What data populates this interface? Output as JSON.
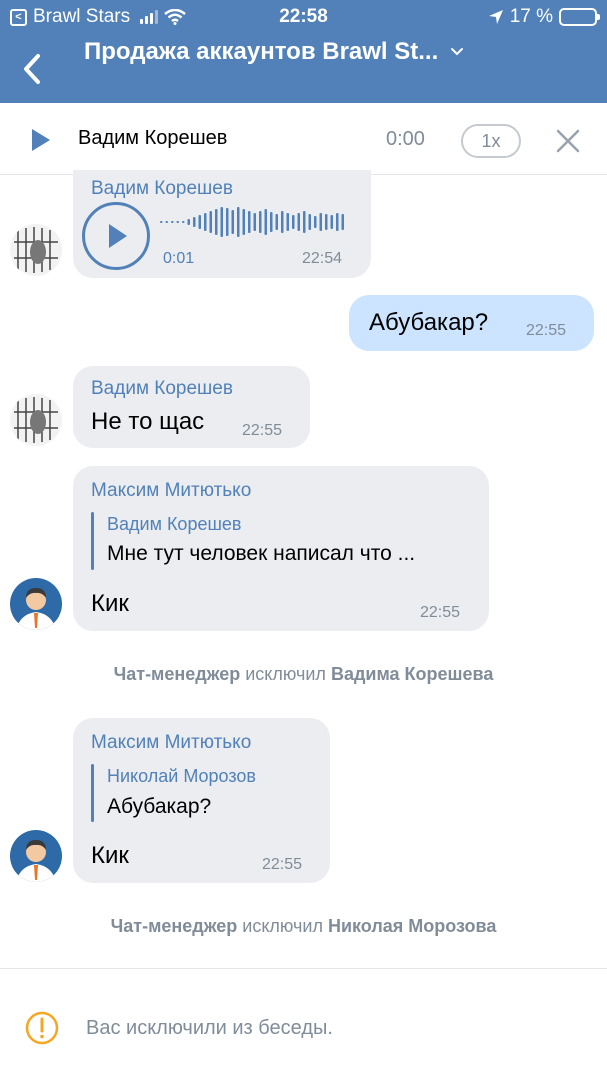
{
  "status_bar": {
    "back_app": "Brawl Stars",
    "time": "22:58",
    "battery": "17 %"
  },
  "header": {
    "title": "Продажа аккаунтов Brawl St..."
  },
  "player": {
    "name": "Вадим Корешев",
    "time": "0:00",
    "speed": "1x"
  },
  "messages": [
    {
      "type": "voice",
      "author": "Вадим Корешев",
      "duration": "0:01",
      "time": "22:54"
    },
    {
      "type": "outgoing",
      "text": "Абубакар?",
      "time": "22:55"
    },
    {
      "type": "text",
      "author": "Вадим Корешев",
      "text": "Не то щас",
      "time": "22:55"
    },
    {
      "type": "reply",
      "author": "Максим Митютько",
      "reply_author": "Вадим Корешев",
      "reply_text": "Мне тут человек написал что ...",
      "text": "Кик",
      "time": "22:55"
    },
    {
      "type": "service",
      "actor": "Чат-менеджер",
      "action": "исключил",
      "target": "Вадима Корешева"
    },
    {
      "type": "reply",
      "author": "Максим Митютько",
      "reply_author": "Николай Морозов",
      "reply_text": "Абубакар?",
      "text": "Кик",
      "time": "22:55"
    },
    {
      "type": "service",
      "actor": "Чат-менеджер",
      "action": "исключил",
      "target": "Николая Морозова"
    }
  ],
  "footer": {
    "notice": "Вас исключили из беседы."
  },
  "colors": {
    "header": "#5181b8",
    "bubble_in": "#ebedf0",
    "bubble_out": "#cce4ff",
    "accent": "#5181b8",
    "warning": "#f5a623"
  }
}
